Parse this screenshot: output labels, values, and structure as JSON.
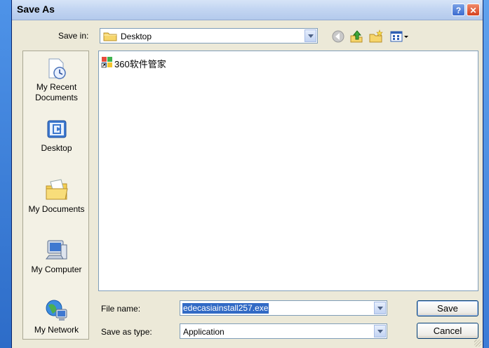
{
  "dialog": {
    "title": "Save As",
    "help_label": "?",
    "close_label": "✕"
  },
  "save_in": {
    "label": "Save in:",
    "value": "Desktop"
  },
  "toolbar": {
    "icons": [
      "back-icon",
      "up-folder-icon",
      "new-folder-icon",
      "view-menu-icon"
    ]
  },
  "places": [
    {
      "label_line1": "My Recent",
      "label_line2": "Documents",
      "icon": "recent-documents-icon"
    },
    {
      "label_line1": "Desktop",
      "label_line2": "",
      "icon": "desktop-icon"
    },
    {
      "label_line1": "My Documents",
      "label_line2": "",
      "icon": "my-documents-icon"
    },
    {
      "label_line1": "My Computer",
      "label_line2": "",
      "icon": "my-computer-icon"
    },
    {
      "label_line1": "My Network",
      "label_line2": "",
      "icon": "my-network-icon"
    }
  ],
  "files": [
    {
      "name": "360软件管家",
      "icon": "shortcut-app-icon"
    }
  ],
  "file_name": {
    "label": "File name:",
    "value": "edecasiainstall257.exe"
  },
  "save_as_type": {
    "label": "Save as type:",
    "value": "Application"
  },
  "buttons": {
    "save": "Save",
    "cancel": "Cancel"
  }
}
